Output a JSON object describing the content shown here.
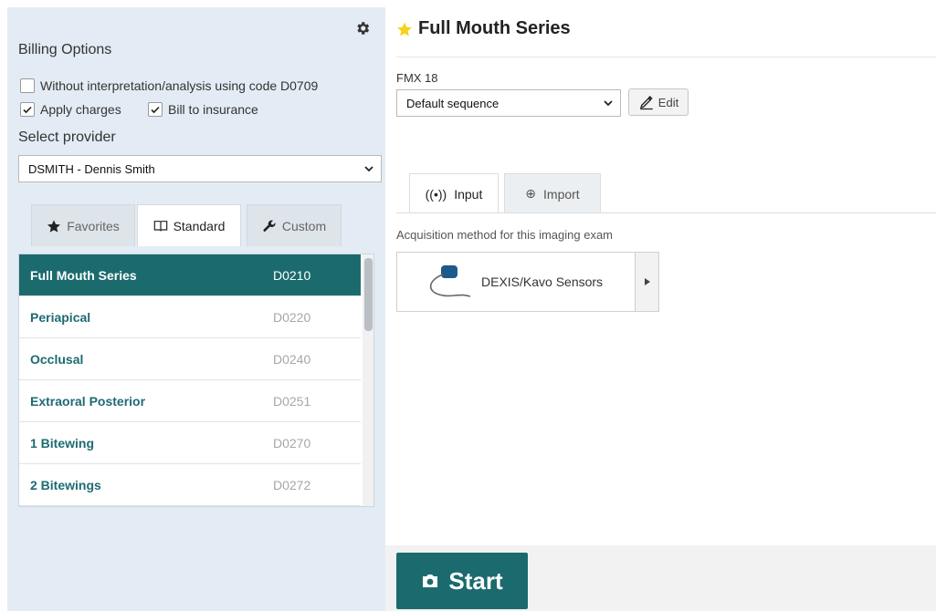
{
  "left": {
    "billing_title": "Billing Options",
    "checkbox_without": "Without interpretation/analysis using code D0709",
    "checkbox_apply": "Apply charges",
    "checkbox_bill": "Bill to insurance",
    "provider_title": "Select provider",
    "provider_value": "DSMITH - Dennis Smith",
    "tabs": [
      "Favorites",
      "Standard",
      "Custom"
    ],
    "items": [
      {
        "name": "Full Mouth Series",
        "code": "D0210"
      },
      {
        "name": "Periapical",
        "code": "D0220"
      },
      {
        "name": "Occlusal",
        "code": "D0240"
      },
      {
        "name": "Extraoral Posterior",
        "code": "D0251"
      },
      {
        "name": "1 Bitewing",
        "code": "D0270"
      },
      {
        "name": "2 Bitewings",
        "code": "D0272"
      }
    ]
  },
  "right": {
    "title": "Full Mouth Series",
    "fmx_label": "FMX 18",
    "sequence_value": "Default sequence",
    "edit_label": "Edit",
    "tabs": [
      "Input",
      "Import"
    ],
    "acq_label": "Acquisition method for this imaging exam",
    "sensor_label": "DEXIS/Kavo Sensors",
    "start_label": "Start"
  },
  "colors": {
    "accent": "#1b6b6e",
    "link": "#1d6b72",
    "star": "#f5d31a",
    "panel": "#e3ecf4"
  }
}
